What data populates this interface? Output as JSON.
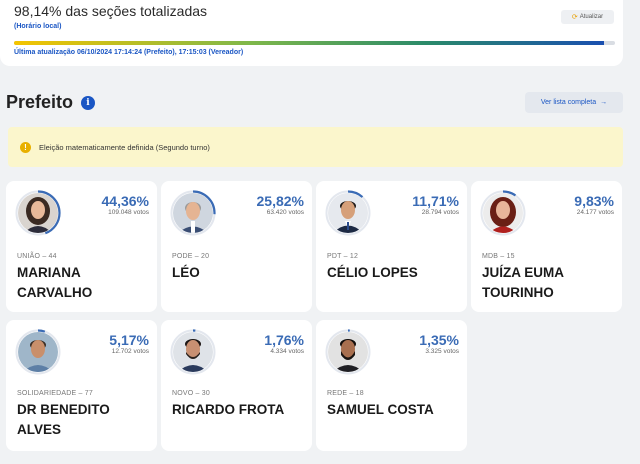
{
  "status": {
    "title": "98,14% das seções totalizadas",
    "subtitle": "(Horário local)",
    "progress_percent": 98.14,
    "updated": "Última atualização 06/10/2024 17:14:24 (Prefeito), 17:15:03 (Vereador)",
    "refresh_label": "Atualizar",
    "refresh_icon": "refresh-icon"
  },
  "section": {
    "title": "Prefeito",
    "info_icon": "info-icon",
    "full_list_label": "Ver lista completa",
    "arrow": "→"
  },
  "alert": {
    "icon": "!",
    "text": "Eleição matematicamente definida (Segundo turno)"
  },
  "candidates": [
    {
      "percent": "44,36%",
      "percent_value": 44.36,
      "votes": "109.048 votos",
      "party": "UNIÃO – 44",
      "name": "MARIANA CARVALHO",
      "avatar": "woman-dark-hair"
    },
    {
      "percent": "25,82%",
      "percent_value": 25.82,
      "votes": "63.420 votos",
      "party": "PODE – 20",
      "name": "LÉO",
      "avatar": "man-gray-hair"
    },
    {
      "percent": "11,71%",
      "percent_value": 11.71,
      "votes": "28.794 votos",
      "party": "PDT – 12",
      "name": "CÉLIO LOPES",
      "avatar": "man-suit"
    },
    {
      "percent": "9,83%",
      "percent_value": 9.83,
      "votes": "24.177 votos",
      "party": "MDB – 15",
      "name": "JUÍZA EUMA TOURINHO",
      "avatar": "woman-red-hair"
    },
    {
      "percent": "5,17%",
      "percent_value": 5.17,
      "votes": "12.702 votos",
      "party": "SOLIDARIEDADE – 77",
      "name": "DR BENEDITO ALVES",
      "avatar": "man-outdoor"
    },
    {
      "percent": "1,76%",
      "percent_value": 1.76,
      "votes": "4.334 votos",
      "party": "NOVO – 30",
      "name": "RICARDO FROTA",
      "avatar": "man-beard"
    },
    {
      "percent": "1,35%",
      "percent_value": 1.35,
      "votes": "3.325 votos",
      "party": "REDE – 18",
      "name": "SAMUEL COSTA",
      "avatar": "man-dark-beard"
    }
  ],
  "colors": {
    "accent": "#1a56c4",
    "percent": "#3a6bb5",
    "alert_bg": "#fbf6cc",
    "alert_icon": "#e8b000"
  }
}
